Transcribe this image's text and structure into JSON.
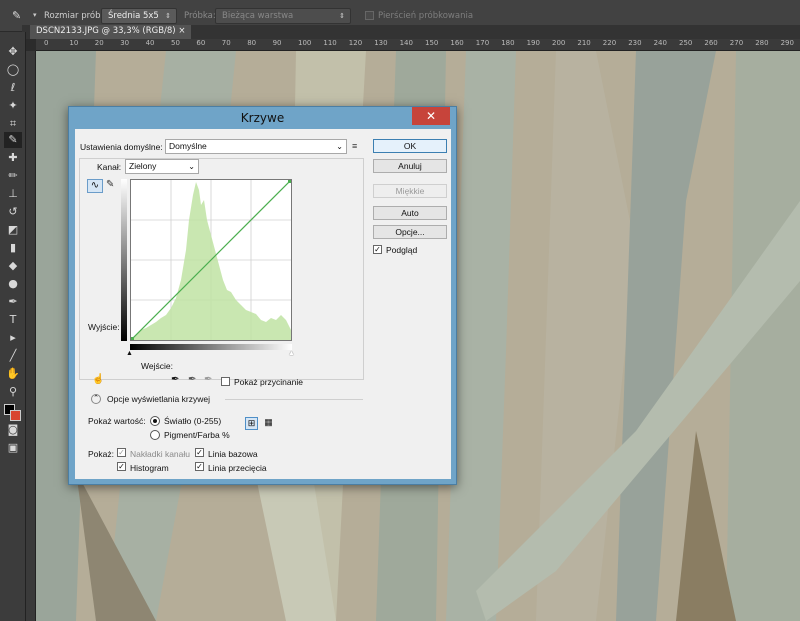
{
  "options_bar": {
    "sample_size_label": "Rozmiar próbki:",
    "sample_size_value": "Średnia 5x5",
    "sample_label": "Próbka:",
    "sample_value": "Bieżąca warstwa",
    "ring_label": "Pierścień próbkowania"
  },
  "doc_tab": {
    "title": "DSCN2133.JPG @ 33,3% (RGB/8)",
    "close": "×"
  },
  "ruler": {
    "ticks": [
      "0",
      "10",
      "20",
      "30",
      "40",
      "50",
      "60",
      "70",
      "80",
      "90",
      "100",
      "110",
      "120",
      "130",
      "140",
      "150",
      "160",
      "170",
      "180",
      "190",
      "200",
      "210",
      "220",
      "230",
      "240",
      "250",
      "260",
      "270",
      "280",
      "290",
      "300"
    ]
  },
  "dialog": {
    "title": "Krzywe",
    "close": "✕",
    "preset_label": "Ustawienia domyślne:",
    "preset_value": "Domyślne",
    "channel_label": "Kanał:",
    "channel_value": "Zielony",
    "output_label": "Wyjście:",
    "input_label": "Wejście:",
    "show_clipping": "Pokaż przycinanie",
    "display_options": "Opcje wyświetlania krzywej",
    "show_amount_label": "Pokaż wartość:",
    "light": "Światło (0-255)",
    "pigment": "Pigment/Farba %",
    "show_label": "Pokaż:",
    "channel_overlays": "Nakładki kanału",
    "baseline": "Linia bazowa",
    "histogram": "Histogram",
    "intersection": "Linia przecięcia",
    "buttons": {
      "ok": "OK",
      "cancel": "Anuluj",
      "smooth": "Miękkie",
      "auto": "Auto",
      "options": "Opcje..."
    },
    "preview": "Podgląd"
  },
  "colors": {
    "dialog_frame": "#6fa4c8",
    "close_red": "#c7443b",
    "histogram": "#bfe3a3",
    "curve": "#4caf50"
  }
}
